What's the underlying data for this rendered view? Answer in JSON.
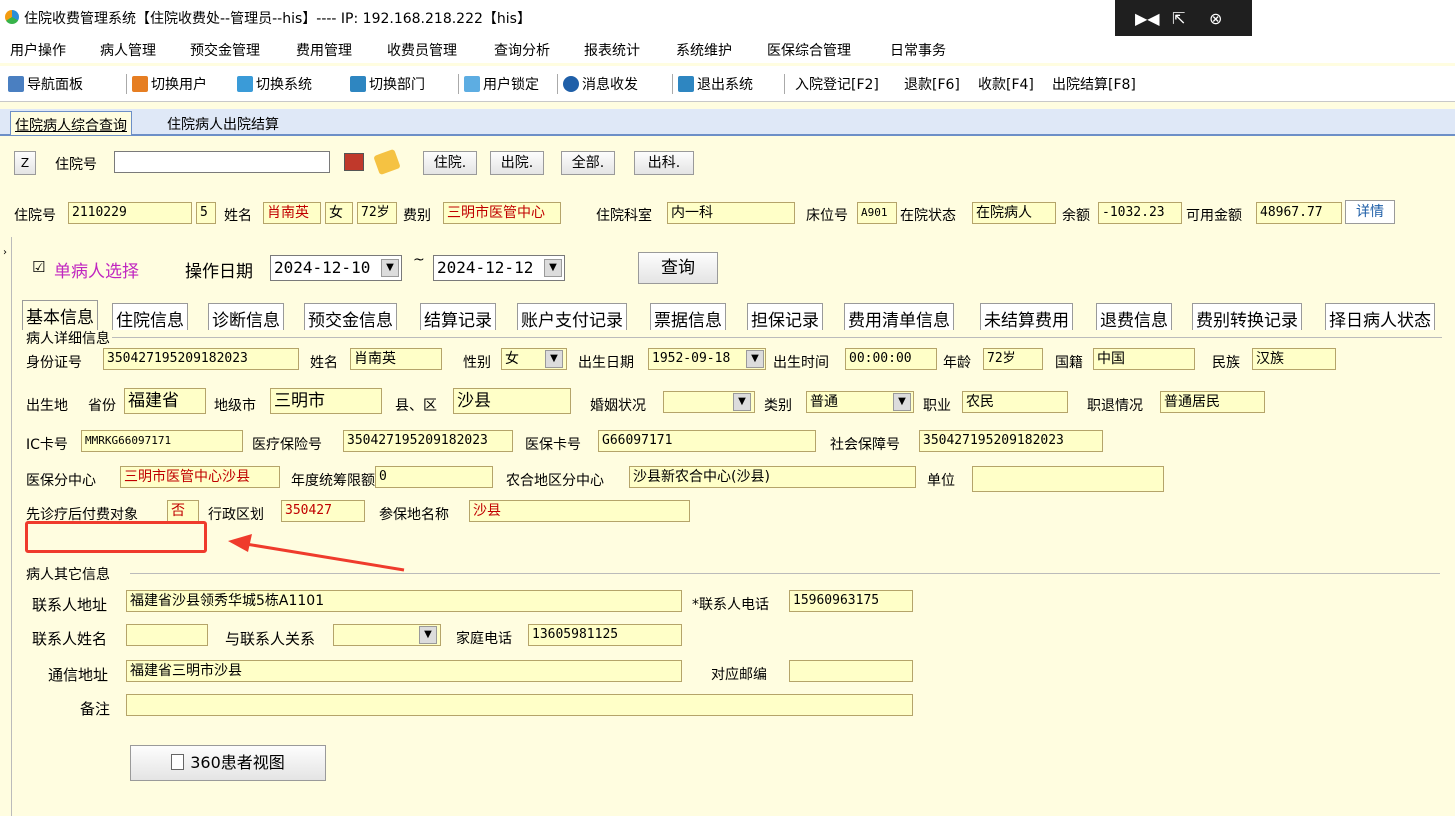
{
  "window": {
    "title": "住院收费管理系统【住院收费处--管理员--his】---- IP: 192.168.218.222【his】",
    "controls": [
      "▶◀",
      "⇱",
      "⊗"
    ]
  },
  "menu": [
    "用户操作",
    "病人管理",
    "预交金管理",
    "费用管理",
    "收费员管理",
    "查询分析",
    "报表统计",
    "系统维护",
    "医保综合管理",
    "日常事务"
  ],
  "toolbar": {
    "items": [
      "导航面板",
      "切换用户",
      "切换系统",
      "切换部门",
      "用户锁定",
      "消息收发",
      "退出系统",
      "入院登记[F2]",
      "退款[F6]",
      "收款[F4]",
      "出院结算[F8]"
    ]
  },
  "tabs": [
    "住院病人综合查询",
    "住院病人出院结算"
  ],
  "search": {
    "z_label": "Z",
    "admission_no_label": "住院号",
    "admission_no_value": "",
    "btn_inhospital": "住院.",
    "btn_discharged": "出院.",
    "btn_all": "全部.",
    "btn_dept": "出科."
  },
  "patient_bar": {
    "admission_no_label": "住院号",
    "admission_no": "2110229",
    "times": "5",
    "name_label": "姓名",
    "name": "肖南英",
    "sex": "女",
    "age": "72岁",
    "fee_type_label": "费别",
    "fee_type": "三明市医管中心",
    "dept_label": "住院科室",
    "dept": "内一科",
    "bed_label": "床位号",
    "bed": "A901",
    "status_label": "在院状态",
    "status": "在院病人",
    "balance_label": "余额",
    "balance": "-1032.23",
    "available_label": "可用金额",
    "available": "48967.77",
    "detail_btn": "详情"
  },
  "query": {
    "single_patient_label": "单病人选择",
    "single_patient_checked": true,
    "date_label": "操作日期",
    "date_from": "2024-12-10",
    "tilde": "~",
    "date_to": "2024-12-12",
    "query_btn": "查询"
  },
  "subtabs": [
    "基本信息",
    "住院信息",
    "诊断信息",
    "预交金信息",
    "结算记录",
    "账户支付记录",
    "票据信息",
    "担保记录",
    "费用清单信息",
    "未结算费用",
    "退费信息",
    "费别转换记录",
    "择日病人状态"
  ],
  "detail": {
    "group_label": "病人详细信息",
    "id_card_label": "身份证号",
    "id_card": "350427195209182023",
    "name_label": "姓名",
    "name": "肖南英",
    "sex_label": "性别",
    "sex": "女",
    "birth_date_label": "出生日期",
    "birth_date": "1952-09-18",
    "birth_time_label": "出生时间",
    "birth_time": "00:00:00",
    "age_label": "年龄",
    "age": "72岁",
    "nationality_label": "国籍",
    "nationality": "中国",
    "ethnicity_label": "民族",
    "ethnicity": "汉族",
    "birthplace_label": "出生地",
    "province_label": "省份",
    "province": "福建省",
    "city_label": "地级市",
    "city": "三明市",
    "county_label": "县、区",
    "county": "沙县",
    "marital_label": "婚姻状况",
    "marital": "",
    "category_label": "类别",
    "category": "普通",
    "occupation_label": "职业",
    "occupation": "农民",
    "retire_label": "职退情况",
    "retire": "普通居民",
    "ic_label": "IC卡号",
    "ic": "MMRKG66097171",
    "insurance_no_label": "医疗保险号",
    "insurance_no": "350427195209182023",
    "insurance_card_label": "医保卡号",
    "insurance_card": "G66097171",
    "social_label": "社会保障号",
    "social": "350427195209182023",
    "ins_center_label": "医保分中心",
    "ins_center": "三明市医管中心沙县",
    "annual_limit_label": "年度统筹限额",
    "annual_limit": "0",
    "rural_center_label": "农合地区分中心",
    "rural_center": "沙县新农合中心(沙县)",
    "unit_label": "单位",
    "unit": "",
    "pay_later_label": "先诊疗后付费对象",
    "pay_later": "否",
    "admin_div_label": "行政区划",
    "admin_div": "350427",
    "insured_place_label": "参保地名称",
    "insured_place": "沙县"
  },
  "other": {
    "group_label": "病人其它信息",
    "contact_addr_label": "联系人地址",
    "contact_addr": "福建省沙县领秀华城5栋A1101",
    "contact_phone_label": "*联系人电话",
    "contact_phone": "15960963175",
    "contact_name_label": "联系人姓名",
    "contact_name": "",
    "relation_label": "与联系人关系",
    "relation": "",
    "home_phone_label": "家庭电话",
    "home_phone": "13605981125",
    "mail_addr_label": "通信地址",
    "mail_addr": "福建省三明市沙县",
    "zip_label": "对应邮编",
    "zip": "",
    "remark_label": "备注",
    "remark": ""
  },
  "view360_btn": "360患者视图",
  "colors": {
    "field_bg": "#ffffc8",
    "accent_red": "#ef3b2c",
    "value_red": "#c00000",
    "tab_blue": "#dfe8f7"
  }
}
